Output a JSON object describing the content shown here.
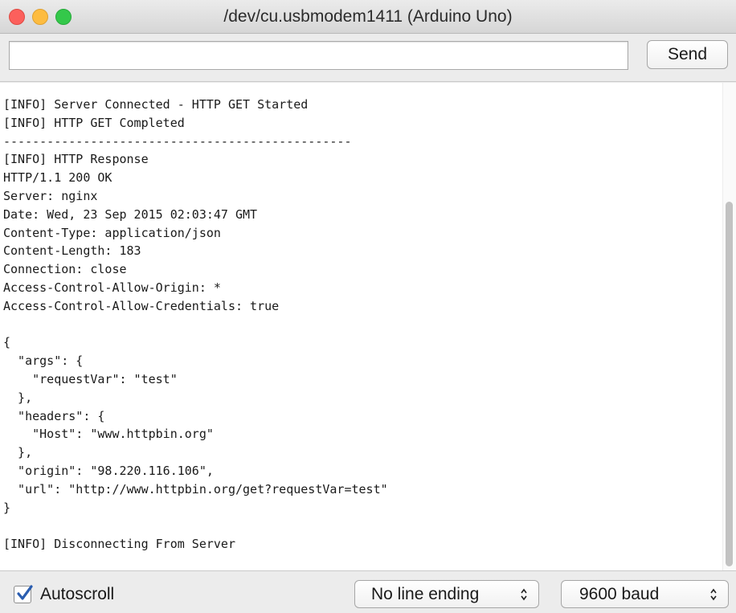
{
  "window": {
    "title": "/dev/cu.usbmodem1411 (Arduino Uno)",
    "buttons": [
      "close",
      "minimize",
      "zoom"
    ]
  },
  "input": {
    "value": "",
    "placeholder": "",
    "send_label": "Send"
  },
  "output": {
    "lines": [
      "[INFO] Server Connected - HTTP GET Started",
      "[INFO] HTTP GET Completed",
      "------------------------------------------------",
      "[INFO] HTTP Response",
      "HTTP/1.1 200 OK",
      "Server: nginx",
      "Date: Wed, 23 Sep 2015 02:03:47 GMT",
      "Content-Type: application/json",
      "Content-Length: 183",
      "Connection: close",
      "Access-Control-Allow-Origin: *",
      "Access-Control-Allow-Credentials: true",
      "",
      "{",
      "  \"args\": {",
      "    \"requestVar\": \"test\"",
      "  },",
      "  \"headers\": {",
      "    \"Host\": \"www.httpbin.org\"",
      "  },",
      "  \"origin\": \"98.220.116.106\",",
      "  \"url\": \"http://www.httpbin.org/get?requestVar=test\"",
      "}",
      "",
      "[INFO] Disconnecting From Server"
    ]
  },
  "footer": {
    "autoscroll_label": "Autoscroll",
    "autoscroll_checked": true,
    "line_ending": "No line ending",
    "baud": "9600 baud"
  },
  "colors": {
    "close": "#fc605c",
    "minimize": "#fdbc40",
    "zoom": "#34c84a",
    "checkmark": "#2a5db0"
  },
  "icons": [
    "checkmark-icon",
    "stepper-arrows-icon"
  ]
}
